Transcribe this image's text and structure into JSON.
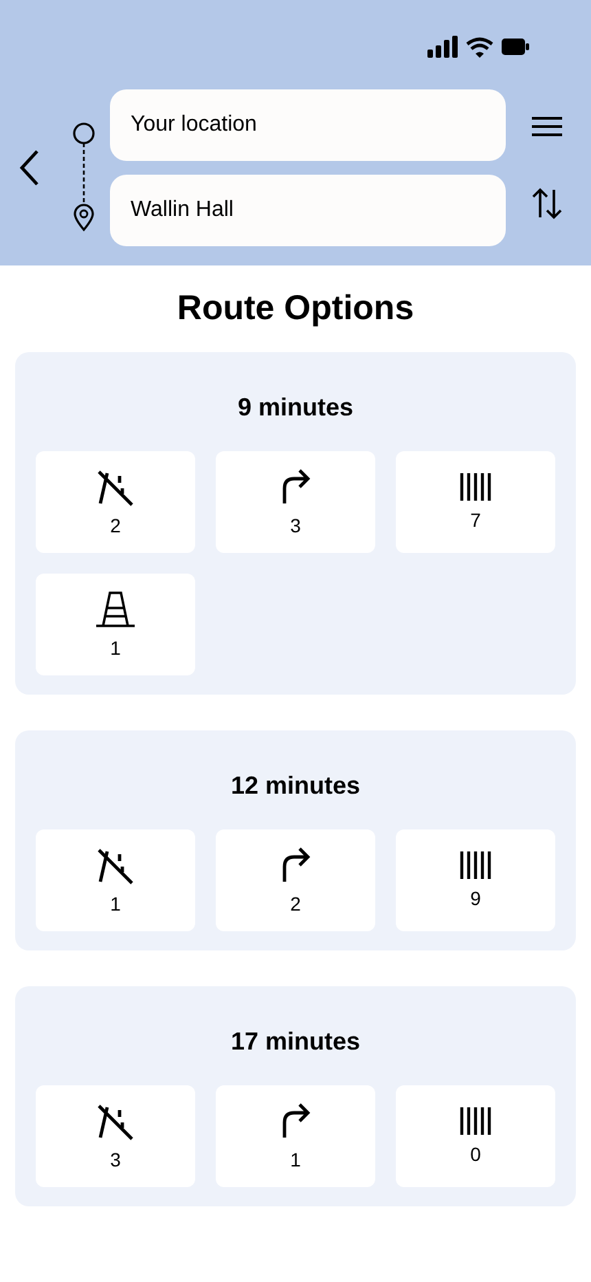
{
  "route": {
    "origin": "Your location",
    "destination": "Wallin Hall"
  },
  "title": "Route Options",
  "options": [
    {
      "duration": "9 minutes",
      "stats": [
        {
          "kind": "road",
          "count": "2"
        },
        {
          "kind": "turn",
          "count": "3"
        },
        {
          "kind": "crossing",
          "count": "7"
        },
        {
          "kind": "cone",
          "count": "1"
        }
      ]
    },
    {
      "duration": "12 minutes",
      "stats": [
        {
          "kind": "road",
          "count": "1"
        },
        {
          "kind": "turn",
          "count": "2"
        },
        {
          "kind": "crossing",
          "count": "9"
        }
      ]
    },
    {
      "duration": "17 minutes",
      "stats": [
        {
          "kind": "road",
          "count": "3"
        },
        {
          "kind": "turn",
          "count": "1"
        },
        {
          "kind": "crossing",
          "count": "0"
        }
      ]
    }
  ]
}
